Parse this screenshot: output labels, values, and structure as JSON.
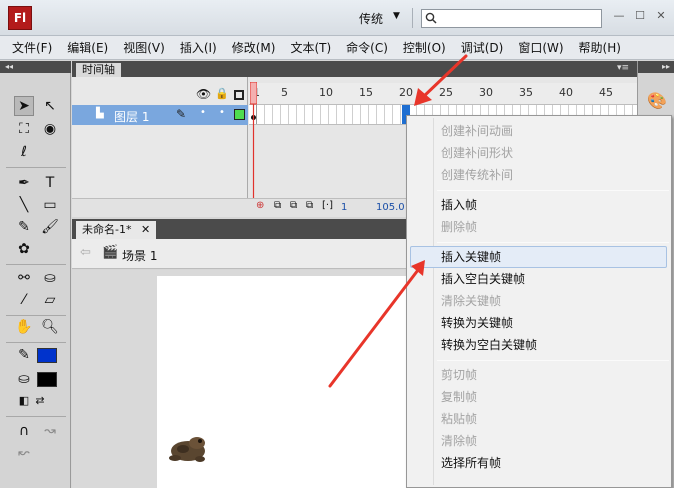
{
  "app": {
    "logo_text": "Fl",
    "workspace_label": "传统",
    "search_placeholder": ""
  },
  "menu": [
    "文件(F)",
    "编辑(E)",
    "视图(V)",
    "插入(I)",
    "修改(M)",
    "文本(T)",
    "命令(C)",
    "控制(O)",
    "调试(D)",
    "窗口(W)",
    "帮助(H)"
  ],
  "timeline": {
    "tab_label": "时间轴",
    "layer_name": "图层 1",
    "ruler_ticks": [
      "1",
      "5",
      "10",
      "15",
      "20",
      "25",
      "30",
      "35",
      "40",
      "45"
    ],
    "current_frame": "1",
    "fps": "105.0"
  },
  "document": {
    "tab_label": "未命名-1*",
    "scene_label": "场景 1"
  },
  "context_menu": [
    {
      "label": "创建补间动画",
      "enabled": false
    },
    {
      "label": "创建补间形状",
      "enabled": false
    },
    {
      "label": "创建传统补间",
      "enabled": false
    },
    {
      "separator": true
    },
    {
      "label": "插入帧",
      "enabled": true
    },
    {
      "label": "删除帧",
      "enabled": false
    },
    {
      "separator": true
    },
    {
      "label": "插入关键帧",
      "enabled": true,
      "highlighted": true
    },
    {
      "label": "插入空白关键帧",
      "enabled": true
    },
    {
      "label": "清除关键帧",
      "enabled": false
    },
    {
      "label": "转换为关键帧",
      "enabled": true
    },
    {
      "label": "转换为空白关键帧",
      "enabled": true
    },
    {
      "separator": true
    },
    {
      "label": "剪切帧",
      "enabled": false
    },
    {
      "label": "复制帧",
      "enabled": false
    },
    {
      "label": "粘贴帧",
      "enabled": false
    },
    {
      "label": "清除帧",
      "enabled": false
    },
    {
      "label": "选择所有帧",
      "enabled": true
    }
  ],
  "colors": {
    "stroke": "#000000",
    "fill": "#0033cc",
    "accent": "#e8352a",
    "layer_highlight": "#7aa7de"
  }
}
